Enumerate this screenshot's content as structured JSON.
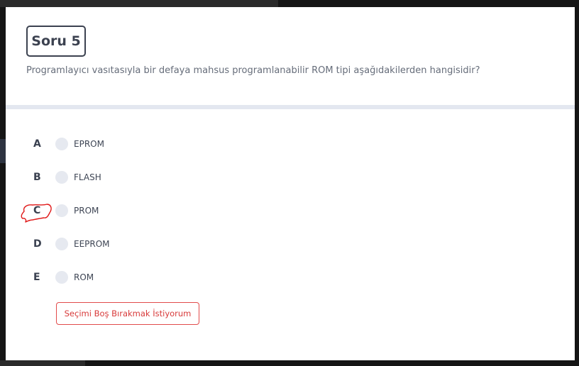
{
  "question": {
    "title": "Soru 5",
    "text": "Programlayıcı vasıtasıyla bir defaya mahsus programlanabilir ROM tipi aşağıdakilerden hangisidir?"
  },
  "options": [
    {
      "letter": "A",
      "label": "EPROM",
      "selected": false
    },
    {
      "letter": "B",
      "label": "FLASH",
      "selected": false
    },
    {
      "letter": "C",
      "label": "PROM",
      "selected": false,
      "annotated": true
    },
    {
      "letter": "D",
      "label": "EEPROM",
      "selected": false
    },
    {
      "letter": "E",
      "label": "ROM",
      "selected": false
    }
  ],
  "skip_button": {
    "label": "Seçimi Boş Bırakmak İstiyorum"
  },
  "colors": {
    "accent_red": "#e24b4b",
    "title_border": "#3c4250",
    "radio_fill": "#e6e9f0",
    "divider": "#e3e7f0",
    "annotation": "#e01818"
  }
}
